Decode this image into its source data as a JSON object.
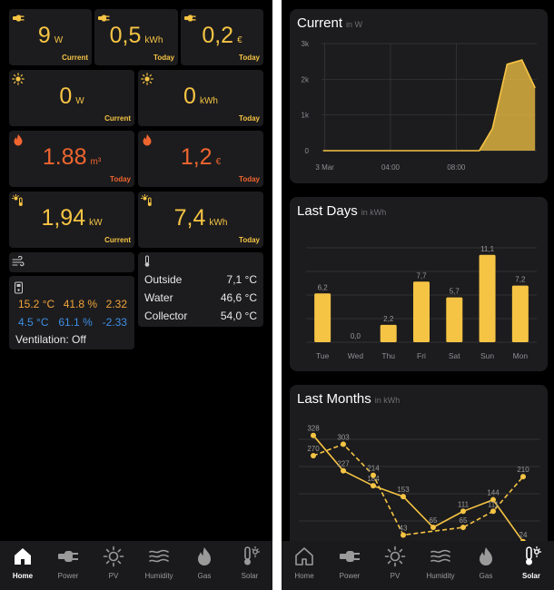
{
  "colors": {
    "accent": "#f6c444",
    "gas": "#f0652f",
    "warm": "#f2a33a",
    "cool": "#3d8ee6",
    "background": "#000000",
    "tile": "#1c1c1e"
  },
  "home": {
    "power_now": {
      "value": "9",
      "unit": "W",
      "caption": "Current",
      "icon": "plug-icon"
    },
    "power_today": {
      "value": "0,5",
      "unit": "kWh",
      "caption": "Today",
      "icon": "plug-icon"
    },
    "cost_today": {
      "value": "0,2",
      "unit": "€",
      "caption": "Today",
      "icon": "plug-icon"
    },
    "pv_now": {
      "value": "0",
      "unit": "W",
      "caption": "Current",
      "icon": "sun-icon"
    },
    "pv_today": {
      "value": "0",
      "unit": "kWh",
      "caption": "Today",
      "icon": "sun-icon"
    },
    "gas_volume": {
      "value": "1.88",
      "unit": "m³",
      "caption": "Today",
      "icon": "flame-icon"
    },
    "gas_cost": {
      "value": "1,2",
      "unit": "€",
      "caption": "Today",
      "icon": "flame-icon"
    },
    "heat_now": {
      "value": "1,94",
      "unit": "kW",
      "caption": "Current",
      "icon": "sun-thermometer-icon"
    },
    "heat_today": {
      "value": "7,4",
      "unit": "kWh",
      "caption": "Today",
      "icon": "sun-thermometer-icon"
    },
    "solar": {
      "rows": [
        {
          "label": "Outside",
          "value": "7,1 °C"
        },
        {
          "label": "Water",
          "value": "46,6 °C"
        },
        {
          "label": "Collector",
          "value": "54,0 °C"
        }
      ]
    },
    "climate": {
      "warm": {
        "temp": "15.2 °C",
        "humidity": "41.8 %",
        "delta": "2.32"
      },
      "cool": {
        "temp": "4.5 °C",
        "humidity": "61.1 %",
        "delta": "-2.33"
      },
      "ventilation": "Ventilation: Off"
    }
  },
  "solar_page": {
    "current_card": {
      "title": "Current",
      "subtitle": "in W"
    },
    "days_card": {
      "title": "Last Days",
      "subtitle": "in kWh"
    },
    "months_card": {
      "title": "Last Months",
      "subtitle": "in kWh"
    }
  },
  "tabs_left": [
    {
      "label": "Home",
      "icon": "home-icon",
      "active": true
    },
    {
      "label": "Power",
      "icon": "plug-icon",
      "active": false
    },
    {
      "label": "PV",
      "icon": "sun-icon",
      "active": false
    },
    {
      "label": "Humidity",
      "icon": "wind-icon",
      "active": false
    },
    {
      "label": "Gas",
      "icon": "flame-icon",
      "active": false
    },
    {
      "label": "Solar",
      "icon": "sun-thermometer-icon",
      "active": false
    }
  ],
  "tabs_right": [
    {
      "label": "Home",
      "icon": "home-icon",
      "active": false
    },
    {
      "label": "Power",
      "icon": "plug-icon",
      "active": false
    },
    {
      "label": "PV",
      "icon": "sun-icon",
      "active": false
    },
    {
      "label": "Humidity",
      "icon": "wind-icon",
      "active": false
    },
    {
      "label": "Gas",
      "icon": "flame-icon",
      "active": false
    },
    {
      "label": "Solar",
      "icon": "sun-thermometer-icon",
      "active": true
    }
  ],
  "chart_data": [
    {
      "type": "area",
      "title": "Current",
      "subtitle": "in W",
      "yticks": [
        "0",
        "1k",
        "2k",
        "3k"
      ],
      "ylim": [
        0,
        3000
      ],
      "xticks": [
        {
          "t": 0.0,
          "label": "3 Mar"
        },
        {
          "t": 4.0,
          "label": "04:00"
        },
        {
          "t": 8.0,
          "label": "08:00"
        }
      ],
      "x": [
        -0.1,
        1,
        2,
        3,
        4,
        5,
        6,
        7,
        8,
        9.4,
        10.2,
        11.1,
        12.0,
        12.8
      ],
      "values": [
        0,
        0,
        0,
        0,
        0,
        0,
        0,
        0,
        0,
        0,
        620,
        2420,
        2540,
        1760
      ],
      "grid": true
    },
    {
      "type": "bar",
      "title": "Last Days",
      "subtitle": "in kWh",
      "categories": [
        "Tue",
        "Wed",
        "Thu",
        "Fri",
        "Sat",
        "Sun",
        "Mon"
      ],
      "values": [
        6.2,
        0.0,
        2.2,
        7.7,
        5.7,
        11.1,
        7.2
      ],
      "labels": [
        "6,2",
        "0,0",
        "2,2",
        "7,7",
        "5,7",
        "11,1",
        "7,2"
      ],
      "ylim": [
        0,
        12
      ],
      "grid": true
    },
    {
      "type": "line",
      "title": "Last Months",
      "subtitle": "in kWh",
      "ylim": [
        0,
        350
      ],
      "grid": true,
      "series": [
        {
          "style": "solid",
          "values": [
            328,
            227,
            184,
            153,
            65,
            111,
            144,
            24
          ]
        },
        {
          "style": "dashed",
          "values": [
            270,
            303,
            214,
            43,
            null,
            65,
            111,
            210
          ]
        }
      ]
    }
  ]
}
